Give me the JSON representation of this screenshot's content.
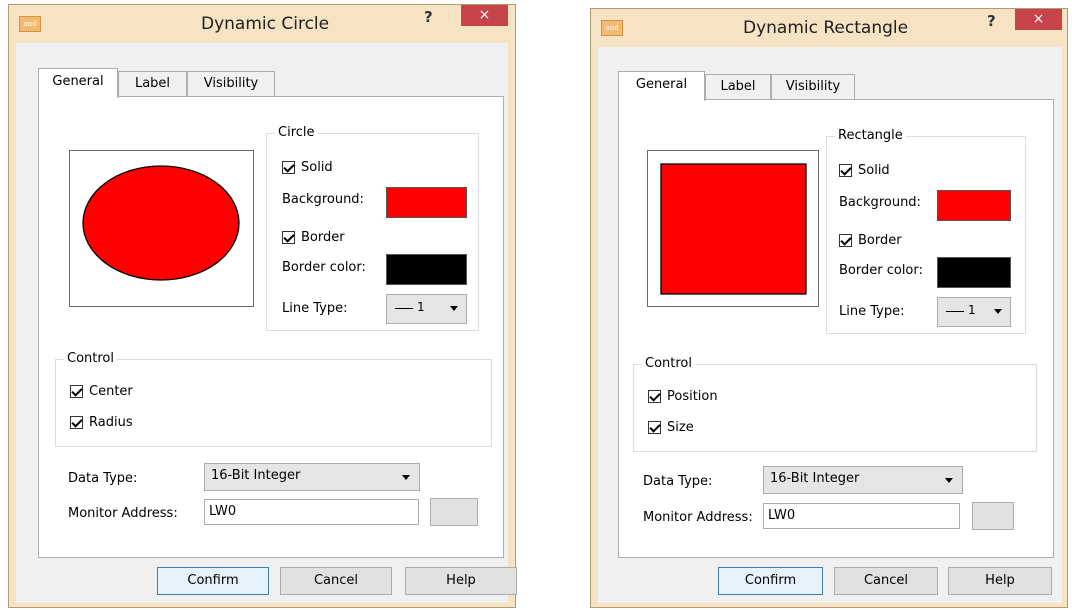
{
  "left_dialog": {
    "title": "Dynamic Circle",
    "app_icon_text": "and",
    "help_glyph": "?",
    "close_glyph": "×",
    "tabs": [
      "General",
      "Label",
      "Visibility"
    ],
    "shape_group": {
      "title": "Circle",
      "solid_label": "Solid",
      "background_label": "Background:",
      "border_label": "Border",
      "border_color_label": "Border color:",
      "line_type_label": "Line Type:",
      "line_type_value": "1"
    },
    "control_group": {
      "title": "Control",
      "items": [
        "Center",
        "Radius"
      ]
    },
    "data_type_label": "Data Type:",
    "data_type_value": "16-Bit Integer",
    "monitor_address_label": "Monitor Address:",
    "monitor_address_value": "LW0",
    "buttons": {
      "confirm": "Confirm",
      "cancel": "Cancel",
      "help": "Help"
    }
  },
  "right_dialog": {
    "title": "Dynamic Rectangle",
    "app_icon_text": "and",
    "help_glyph": "?",
    "close_glyph": "×",
    "tabs": [
      "General",
      "Label",
      "Visibility"
    ],
    "shape_group": {
      "title": "Rectangle",
      "solid_label": "Solid",
      "background_label": "Background:",
      "border_label": "Border",
      "border_color_label": "Border color:",
      "line_type_label": "Line Type:",
      "line_type_value": "1"
    },
    "control_group": {
      "title": "Control",
      "items": [
        "Position",
        "Size"
      ]
    },
    "data_type_label": "Data Type:",
    "data_type_value": "16-Bit Integer",
    "monitor_address_label": "Monitor Address:",
    "monitor_address_value": "LW0",
    "buttons": {
      "confirm": "Confirm",
      "cancel": "Cancel",
      "help": "Help"
    }
  },
  "colors": {
    "background_swatch": "#ff0000",
    "border_swatch": "#000000",
    "shape_fill": "#ff0000",
    "close_button": "#c7444a",
    "frame": "#f6e3c4"
  },
  "checkbox_states": {
    "solid": true,
    "border": true,
    "control_1": true,
    "control_2": true
  }
}
